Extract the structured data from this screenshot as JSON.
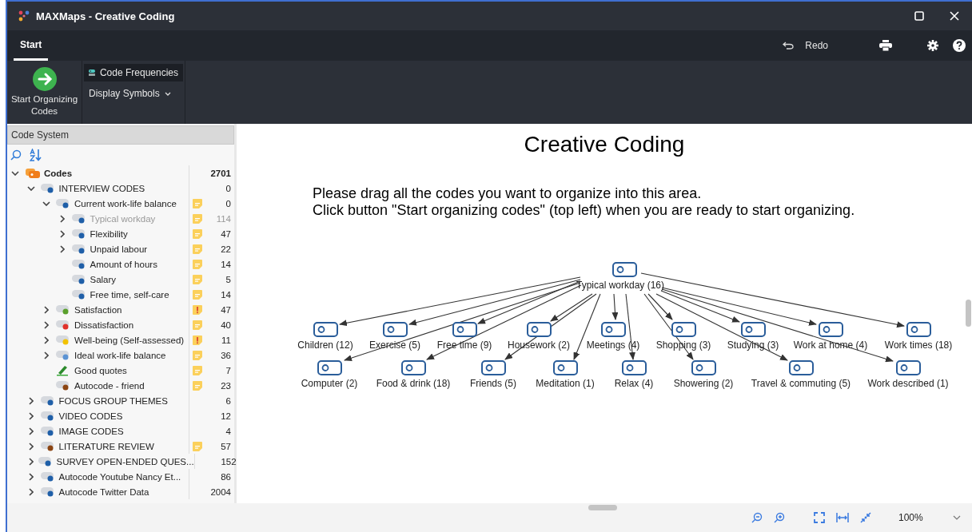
{
  "window": {
    "title": "MAXMaps - Creative Coding"
  },
  "tabs": [
    {
      "label": "Start",
      "selected": true
    }
  ],
  "toolbar": {
    "redo": "Redo"
  },
  "ribbon": {
    "start_button": "Start Organizing Codes",
    "code_frequencies": {
      "label": "Code Frequencies",
      "selected": true
    },
    "display_symbols": "Display Symbols"
  },
  "code_system": {
    "title": "Code System",
    "tree": [
      {
        "label": "Codes",
        "kind": "folder",
        "count": "2701",
        "memo": false,
        "expanded": true,
        "dimmed": false,
        "children": [
          {
            "label": "INTERVIEW CODES",
            "kind": "code",
            "color": "#1f5fa8",
            "memo": false,
            "count": "0",
            "expanded": true,
            "dimmed": false,
            "children": [
              {
                "label": "Current work-life balance",
                "kind": "code",
                "color": "#1f5fa8",
                "memo": true,
                "important": false,
                "count": "0",
                "expanded": true,
                "dimmed": false,
                "children": [
                  {
                    "label": "Typical workday",
                    "kind": "code",
                    "color": "#1f5fa8",
                    "memo": true,
                    "important": false,
                    "count": "114",
                    "expanded": false,
                    "dimmed": true
                  },
                  {
                    "label": "Flexibility",
                    "kind": "code",
                    "color": "#1f5fa8",
                    "memo": true,
                    "important": false,
                    "count": "47",
                    "expanded": false,
                    "dimmed": false
                  },
                  {
                    "label": "Unpaid labour",
                    "kind": "code",
                    "color": "#1f5fa8",
                    "memo": true,
                    "important": false,
                    "count": "22",
                    "expanded": false,
                    "dimmed": false
                  },
                  {
                    "label": "Amount of hours",
                    "kind": "code",
                    "color": "#1f5fa8",
                    "memo": true,
                    "important": false,
                    "count": "14",
                    "dimmed": false
                  },
                  {
                    "label": "Salary",
                    "kind": "code",
                    "color": "#1f5fa8",
                    "memo": true,
                    "important": false,
                    "count": "5",
                    "dimmed": false
                  },
                  {
                    "label": "Free time, self-care",
                    "kind": "code",
                    "color": "#1f5fa8",
                    "memo": true,
                    "important": false,
                    "count": "14",
                    "dimmed": false
                  }
                ]
              },
              {
                "label": "Satisfaction",
                "kind": "code",
                "color": "#5aa02c",
                "memo": true,
                "important": true,
                "count": "47",
                "expanded": false,
                "dimmed": false
              },
              {
                "label": "Dissatisfaction",
                "kind": "code",
                "color": "#e0312b",
                "memo": true,
                "important": false,
                "count": "40",
                "expanded": false,
                "dimmed": false
              },
              {
                "label": "Well-being (Self-assessed)",
                "kind": "code",
                "color": "#f2c200",
                "memo": true,
                "important": true,
                "count": "11",
                "expanded": false,
                "dimmed": false
              },
              {
                "label": "Ideal work-life balance",
                "kind": "code",
                "color": "#5b93d3",
                "memo": true,
                "important": false,
                "count": "36",
                "expanded": false,
                "dimmed": false
              },
              {
                "label": "Good quotes",
                "kind": "highlighter",
                "memo": true,
                "important": false,
                "count": "7",
                "dimmed": false
              },
              {
                "label": "Autocode - friend",
                "kind": "code",
                "color": "#8b4513",
                "memo": true,
                "important": false,
                "count": "23",
                "dimmed": false
              }
            ]
          },
          {
            "label": "FOCUS GROUP THEMES",
            "kind": "code",
            "color": "#1f5fa8",
            "memo": false,
            "count": "6",
            "expanded": false,
            "dimmed": false
          },
          {
            "label": "VIDEO CODES",
            "kind": "code",
            "color": "#1f5fa8",
            "memo": false,
            "count": "12",
            "expanded": false,
            "dimmed": false
          },
          {
            "label": "IMAGE CODES",
            "kind": "code",
            "color": "#1f5fa8",
            "memo": false,
            "count": "4",
            "expanded": false,
            "dimmed": false
          },
          {
            "label": "LITERATURE REVIEW",
            "kind": "code",
            "color": "#8b4513",
            "memo": true,
            "important": false,
            "count": "57",
            "expanded": false,
            "dimmed": false
          },
          {
            "label": "SURVEY OPEN-ENDED QUES...",
            "kind": "code",
            "color": "#1f5fa8",
            "memo": false,
            "count": "152",
            "expanded": false,
            "dimmed": false
          },
          {
            "label": "Autocode Youtube Nancy Et...",
            "kind": "code",
            "color": "#1f5fa8",
            "memo": false,
            "count": "86",
            "expanded": false,
            "dimmed": false
          },
          {
            "label": "Autocode Twitter Data",
            "kind": "code",
            "color": "#1f5fa8",
            "memo": false,
            "count": "2004",
            "expanded": false,
            "dimmed": false
          }
        ]
      }
    ]
  },
  "map": {
    "title": "Creative Coding",
    "instructions": [
      "Please drag all the codes you want to organize into this area.",
      "Click button \"Start organizing codes\" (top left) when you are ready to start organizing."
    ],
    "root": "Typical workday (16)",
    "nodes": [
      "Children (12)",
      "Exercise (5)",
      "Free time (9)",
      "Housework (2)",
      "Meetings (4)",
      "Shopping (3)",
      "Studying (3)",
      "Work at home (4)",
      "Work times (18)",
      "Computer (2)",
      "Food & drink (18)",
      "Friends (5)",
      "Meditation (1)",
      "Relax (4)",
      "Showering (2)",
      "Travel & commuting (5)",
      "Work described (1)"
    ]
  },
  "zoom": {
    "value": "100%"
  }
}
